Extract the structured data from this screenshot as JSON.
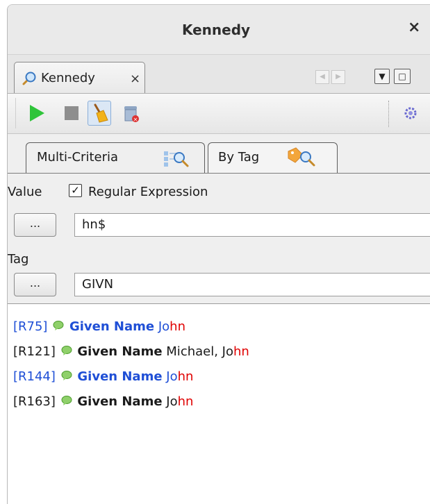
{
  "window": {
    "title": "Kennedy",
    "close_symbol": "×"
  },
  "doc_tab": {
    "label": "Kennedy",
    "close_symbol": "×",
    "icon": "search-icon"
  },
  "tab_nav": {
    "left_arrow": "◀",
    "right_arrow": "▶",
    "menu_arrow": "▼",
    "maximize": "□"
  },
  "toolbar": {
    "buttons": [
      "start-icon",
      "stop-icon",
      "clean-icon",
      "clear-results-icon",
      "settings-icon"
    ]
  },
  "criteria_tabs": [
    {
      "label": "Multi-Criteria",
      "icon": "multi-search-icon",
      "active": false
    },
    {
      "label": "By Tag",
      "icon": "tag-search-icon",
      "active": true
    }
  ],
  "form": {
    "value_label": "Value",
    "regex_checked": true,
    "regex_check_mark": "✓",
    "regex_label": "Regular Expression",
    "value_button": "...",
    "value_input": "hn$",
    "tag_label": "Tag",
    "tag_button": "...",
    "tag_input": "GIVN"
  },
  "results": [
    {
      "ref": "[R75]",
      "tag": "Given Name",
      "prefix": "",
      "match_pre": "Jo",
      "match": "hn",
      "color": "blue"
    },
    {
      "ref": "[R121]",
      "tag": "Given Name",
      "prefix": "Michael, ",
      "match_pre": "Jo",
      "match": "hn",
      "color": "black"
    },
    {
      "ref": "[R144]",
      "tag": "Given Name",
      "prefix": "",
      "match_pre": "Jo",
      "match": "hn",
      "color": "blue"
    },
    {
      "ref": "[R163]",
      "tag": "Given Name",
      "prefix": "",
      "match_pre": "Jo",
      "match": "hn",
      "color": "black"
    }
  ],
  "colors": {
    "link_blue": "#1f4fd6",
    "match_red": "#e00000",
    "play_green": "#2fc43a"
  }
}
